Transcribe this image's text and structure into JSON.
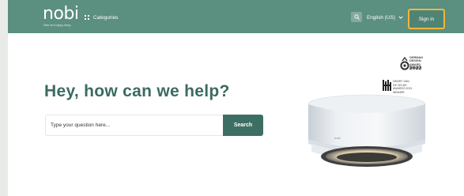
{
  "header": {
    "logo_text": "nobi",
    "logo_tagline": "Safe and happy living",
    "categories_label": "Categories",
    "search_icon": "search-icon",
    "language_label": "English (US)",
    "sign_in_label": "Sign in"
  },
  "hero": {
    "title": "Hey, how can we help?",
    "search_placeholder": "Type your question here...",
    "search_button_label": "Search"
  },
  "awards": {
    "german_design": {
      "text": "GERMAN\nDESIGN\nAWARD\nWINNER",
      "year": "2022"
    },
    "henry_van_de_velde": {
      "text": "HENRY VAN\nDE VELDE\nAWARDS 2021\nWINNER"
    }
  },
  "device": {
    "label": "nobi"
  },
  "colors": {
    "topbar": "#5b8f80",
    "accent_dark": "#3d6e63",
    "title_text": "#3b6b60",
    "highlight_ring": "#f0b63e"
  }
}
